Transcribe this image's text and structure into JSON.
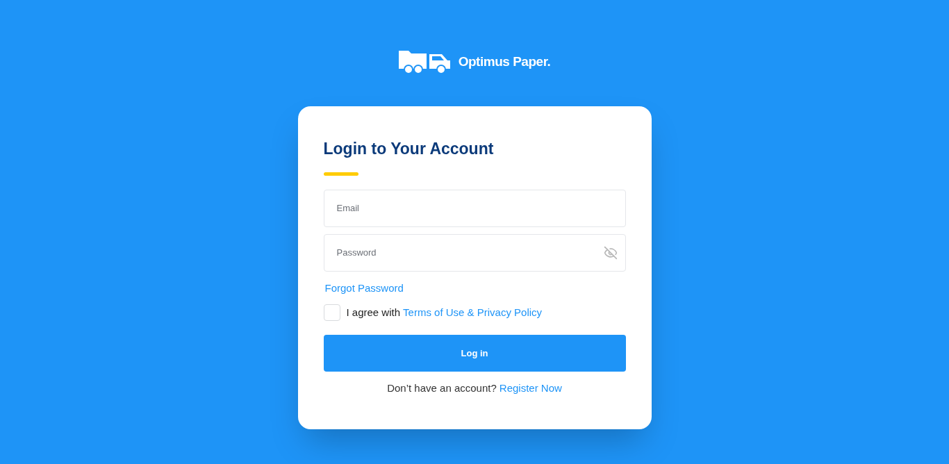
{
  "brand": {
    "name": "Optimus Paper."
  },
  "card": {
    "title": "Login to Your Account",
    "fields": [
      {
        "kind": "email",
        "placeholder": "Email"
      },
      {
        "kind": "password",
        "placeholder": "Password"
      }
    ],
    "forgot_link": "Forgot Password",
    "agree": {
      "checked": false,
      "text": "I agree with",
      "link": "Terms of Use & Privacy Policy"
    },
    "submit": "Log in",
    "register": {
      "text": "Don’t have an account?",
      "link": "Register Now"
    }
  }
}
